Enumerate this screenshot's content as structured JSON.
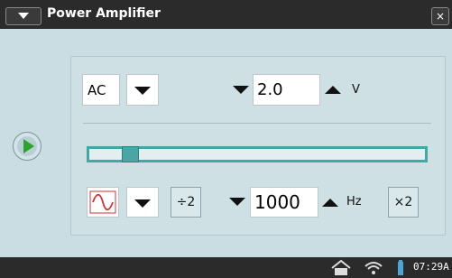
{
  "window": {
    "title": "Power Amplifier",
    "close_label": "×"
  },
  "panel": {
    "mode": {
      "value": "AC"
    },
    "amplitude": {
      "value": "2.0",
      "unit": "V"
    },
    "slider": {
      "level": 0.11
    },
    "frequency": {
      "value": "1000",
      "unit": "Hz"
    },
    "half_button": "÷2",
    "double_button": "×2",
    "waveform": "sine"
  },
  "taskbar": {
    "time": "07:29A"
  },
  "icons": {
    "play": "play-icon",
    "home": "home-icon",
    "wifi": "wifi-icon",
    "battery": "battery-icon"
  }
}
